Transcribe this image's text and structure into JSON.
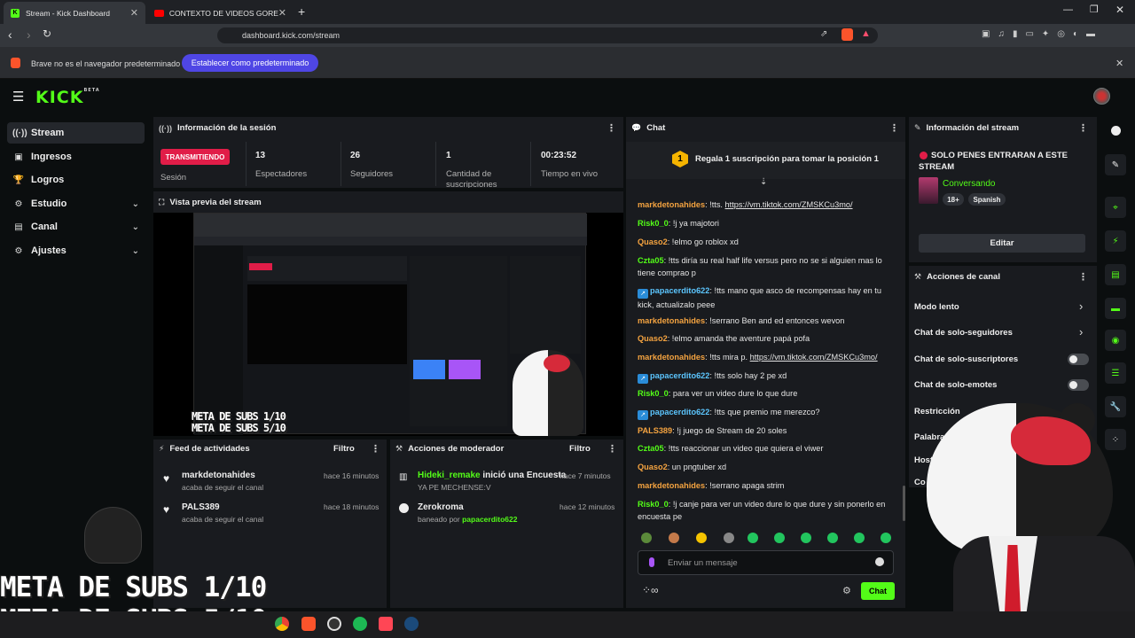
{
  "browser": {
    "tabs": [
      {
        "label": "Stream - Kick Dashboard"
      },
      {
        "label": "CONTEXTO DE VIDEOS GORE QUE S..."
      }
    ],
    "url": "dashboard.kick.com/stream",
    "infobar": {
      "message": "Brave no es el navegador predeterminado",
      "button": "Establecer como predeterminado"
    }
  },
  "app": {
    "logo": "KICK",
    "logo_badge": "BETA",
    "nav": [
      {
        "label": "Stream",
        "icon": "broadcast-icon"
      },
      {
        "label": "Ingresos",
        "icon": "money-icon"
      },
      {
        "label": "Logros",
        "icon": "trophy-icon"
      },
      {
        "label": "Estudio",
        "icon": "studio-icon"
      },
      {
        "label": "Canal",
        "icon": "channel-icon"
      },
      {
        "label": "Ajustes",
        "icon": "gear-icon"
      }
    ]
  },
  "session": {
    "title": "Información de la sesión",
    "status": "TRANSMITIENDO",
    "status_label": "Sesión",
    "stats": [
      {
        "value": "13",
        "label": "Espectadores"
      },
      {
        "value": "26",
        "label": "Seguidores"
      },
      {
        "value": "1",
        "label": "Cantidad de suscripciones"
      },
      {
        "value": "00:23:52",
        "label": "Tiempo en vivo"
      }
    ]
  },
  "preview": {
    "title": "Vista previa del stream",
    "meta1": "META DE SUBS 1/10",
    "meta2": "META DE SUBS 5/10"
  },
  "feed": {
    "title": "Feed de actividades",
    "filter": "Filtro",
    "items": [
      {
        "name": "markdetonahides",
        "sub": "acaba de seguir el canal",
        "time": "hace 16 minutos"
      },
      {
        "name": "PALS389",
        "sub": "acaba de seguir el canal",
        "time": "hace 18 minutos"
      }
    ]
  },
  "modactions": {
    "title": "Acciones de moderador",
    "filter": "Filtro",
    "items": [
      {
        "name": "Hideki_remake",
        "action": " inició una Encuesta",
        "sub": "YA PE MECHENSE:V",
        "time": "hace 7 minutos"
      },
      {
        "name": "Zerokroma",
        "action": "",
        "sub_prefix": "baneado por ",
        "sub_user": "papacerdito622",
        "time": "hace 12 minutos"
      }
    ]
  },
  "chat": {
    "title": "Chat",
    "pinned_rank": "1",
    "pinned": "Regala 1 suscripción para tomar la posición 1",
    "messages": [
      {
        "user": "markdetonahides",
        "color": "#f4a340",
        "text": ": !tts. ",
        "link": "https://vm.tiktok.com/ZMSKCu3mo/"
      },
      {
        "user": "Risk0_0",
        "color": "#53fc18",
        "text": ": !j ya majotori"
      },
      {
        "user": "Quaso2",
        "color": "#f4a340",
        "text": ": !elmo go roblox xd"
      },
      {
        "user": "Czta05",
        "color": "#53fc18",
        "text": ": !tts diría su real half life versus pero no se si alguien mas lo tiene comprao p"
      },
      {
        "user": "papacerdito622",
        "color": "#5cc6ff",
        "text": ": !tts mano que asco de recompensas hay en tu kick, actualizalo peee",
        "badge": true
      },
      {
        "user": "markdetonahides",
        "color": "#f4a340",
        "text": ": !serrano Ben and ed entonces wevon"
      },
      {
        "user": "Quaso2",
        "color": "#f4a340",
        "text": ": !elmo amanda the aventure papá pofa"
      },
      {
        "user": "markdetonahides",
        "color": "#f4a340",
        "text": ": !tts mira p. ",
        "link": "https://vm.tiktok.com/ZMSKCu3mo/"
      },
      {
        "user": "papacerdito622",
        "color": "#5cc6ff",
        "text": ": !tts solo hay 2 pe xd",
        "badge": true
      },
      {
        "user": "Risk0_0",
        "color": "#53fc18",
        "text": ": para ver un video dure lo que dure"
      },
      {
        "user": "papacerdito622",
        "color": "#5cc6ff",
        "text": ": !tts que premio me merezco?",
        "badge": true
      },
      {
        "user": "PALS389",
        "color": "#f4a340",
        "text": ": !j juego de Stream de 20 soles"
      },
      {
        "user": "Czta05",
        "color": "#53fc18",
        "text": ": !tts reaccionar un video que quiera el viwer"
      },
      {
        "user": "Quaso2",
        "color": "#f4a340",
        "text": ": un pngtuber xd"
      },
      {
        "user": "markdetonahides",
        "color": "#f4a340",
        "text": ": !serrano apaga strim"
      },
      {
        "user": "Risk0_0",
        "color": "#53fc18",
        "text": ": !j canje para ver un video dure lo que dure y sin ponerlo en encuesta pe"
      }
    ],
    "input_placeholder": "Enviar un mensaje",
    "send": "Chat"
  },
  "streaminfo": {
    "title": "Información del stream",
    "stream_title": "SOLO PENES ENTRARAN A ESTE STREAM",
    "category": "Conversando",
    "tags": [
      "18+",
      "Spanish"
    ],
    "edit": "Editar"
  },
  "channelactions": {
    "title": "Acciones de canal",
    "items": [
      {
        "label": "Modo lento"
      },
      {
        "label": "Chat de solo-seguidores"
      },
      {
        "label": "Chat de solo-suscriptores"
      },
      {
        "label": "Chat de solo-emotes"
      },
      {
        "label": "Restricción"
      },
      {
        "label": "Palabras"
      },
      {
        "label": "Host"
      },
      {
        "label": "Co"
      }
    ]
  }
}
